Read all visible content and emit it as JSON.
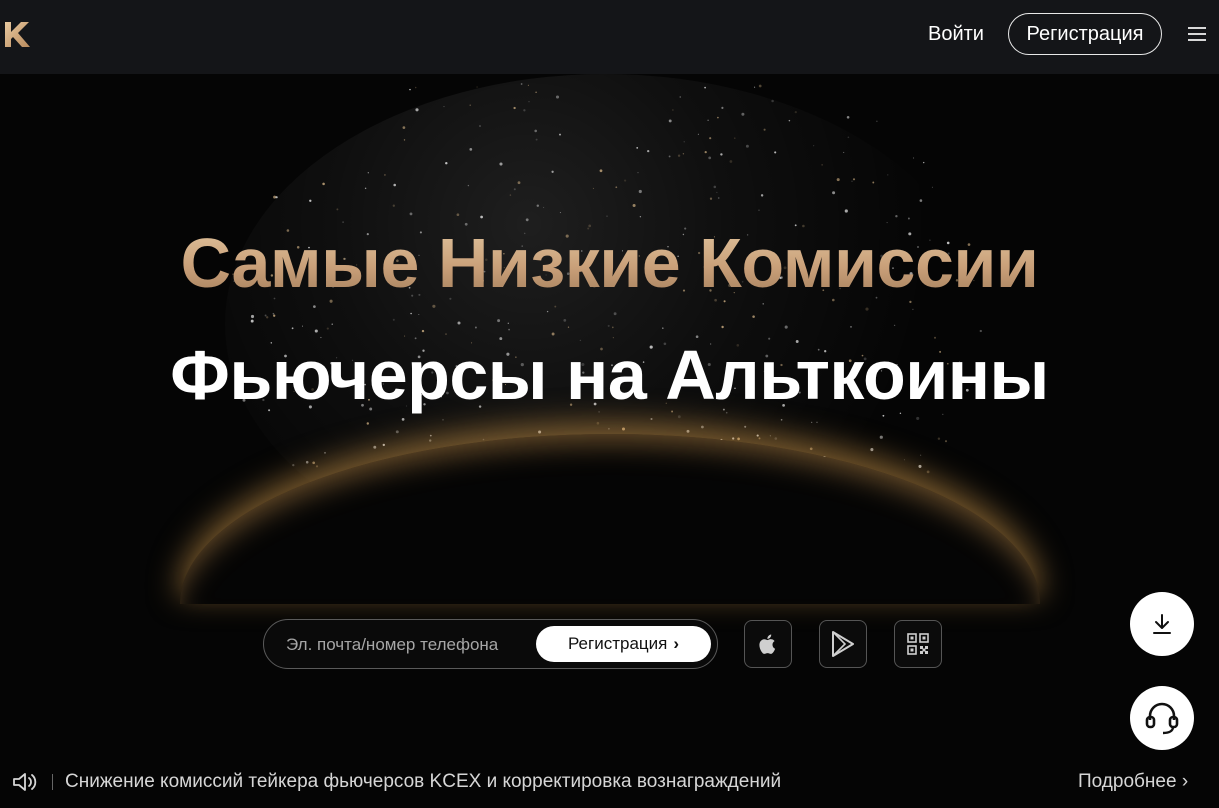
{
  "header": {
    "logo_icon": "kcex-logo-icon",
    "login_label": "Войти",
    "register_label": "Регистрация",
    "menu_icon": "hamburger-menu-icon"
  },
  "hero": {
    "title_line1": "Самые Низкие Комиссии",
    "title_line2": "Фьючерсы на Альткоины",
    "signup": {
      "placeholder": "Эл. почта/номер телефона",
      "button_label": "Регистрация",
      "button_arrow": "›"
    },
    "stores": [
      "apple-icon",
      "google-play-icon",
      "qr-code-icon"
    ]
  },
  "floating": {
    "download_icon": "download-icon",
    "support_icon": "headset-icon"
  },
  "announcement": {
    "icon": "speaker-icon",
    "text": "Снижение комиссий тейкера фьючерсов KCEX и корректировка вознаграждений",
    "more_label": "Подробнее ›"
  },
  "colors": {
    "accent_gold": "#c9a27a",
    "header_bg": "#141518",
    "page_bg": "#050505"
  }
}
